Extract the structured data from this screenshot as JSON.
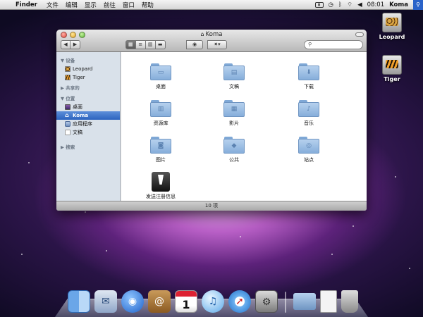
{
  "menubar": {
    "apple_icon": "apple-icon",
    "app_name": "Finder",
    "menus": [
      "文件",
      "编辑",
      "显示",
      "前往",
      "窗口",
      "帮助"
    ],
    "clock": "08:01",
    "user": "Koma",
    "status_icons": [
      "battery-icon",
      "time-machine-icon",
      "bluetooth-icon",
      "wifi-icon",
      "volume-icon",
      "spotlight-icon"
    ]
  },
  "desktop": {
    "icons": [
      {
        "label": "Leopard"
      },
      {
        "label": "Tiger"
      }
    ]
  },
  "window": {
    "title": "Koma",
    "status": "10 项",
    "toolbar": {
      "view_modes": [
        "icon-view",
        "list-view",
        "column-view",
        "coverflow-view"
      ],
      "selected_view": "icon-view"
    },
    "sidebar": {
      "sections": [
        {
          "header": "设备",
          "items": [
            "Leopard",
            "Tiger"
          ]
        },
        {
          "header": "共享的",
          "items": []
        },
        {
          "header": "位置",
          "items": [
            "桌面",
            "Koma",
            "应用程序",
            "文稿"
          ]
        },
        {
          "header": "搜索",
          "items": []
        }
      ],
      "selected": "Koma"
    },
    "items": [
      {
        "name": "桌面",
        "glyph": "▭"
      },
      {
        "name": "文稿",
        "glyph": "▤"
      },
      {
        "name": "下载",
        "glyph": "⬇"
      },
      {
        "name": "资源库",
        "glyph": "▥"
      },
      {
        "name": "影片",
        "glyph": "▦"
      },
      {
        "name": "音乐",
        "glyph": "♪"
      },
      {
        "name": "图片",
        "glyph": "◙"
      },
      {
        "name": "公共",
        "glyph": "◆"
      },
      {
        "name": "站点",
        "glyph": "◎"
      },
      {
        "name": "发送注册信息",
        "glyph": ""
      }
    ]
  },
  "dock": {
    "apps": [
      "Finder",
      "Mail",
      "iChat",
      "Address Book",
      "iCal",
      "iTunes",
      "Safari",
      "System Preferences",
      "Applications",
      "Documents",
      "Trash"
    ],
    "ical_day": "1"
  }
}
